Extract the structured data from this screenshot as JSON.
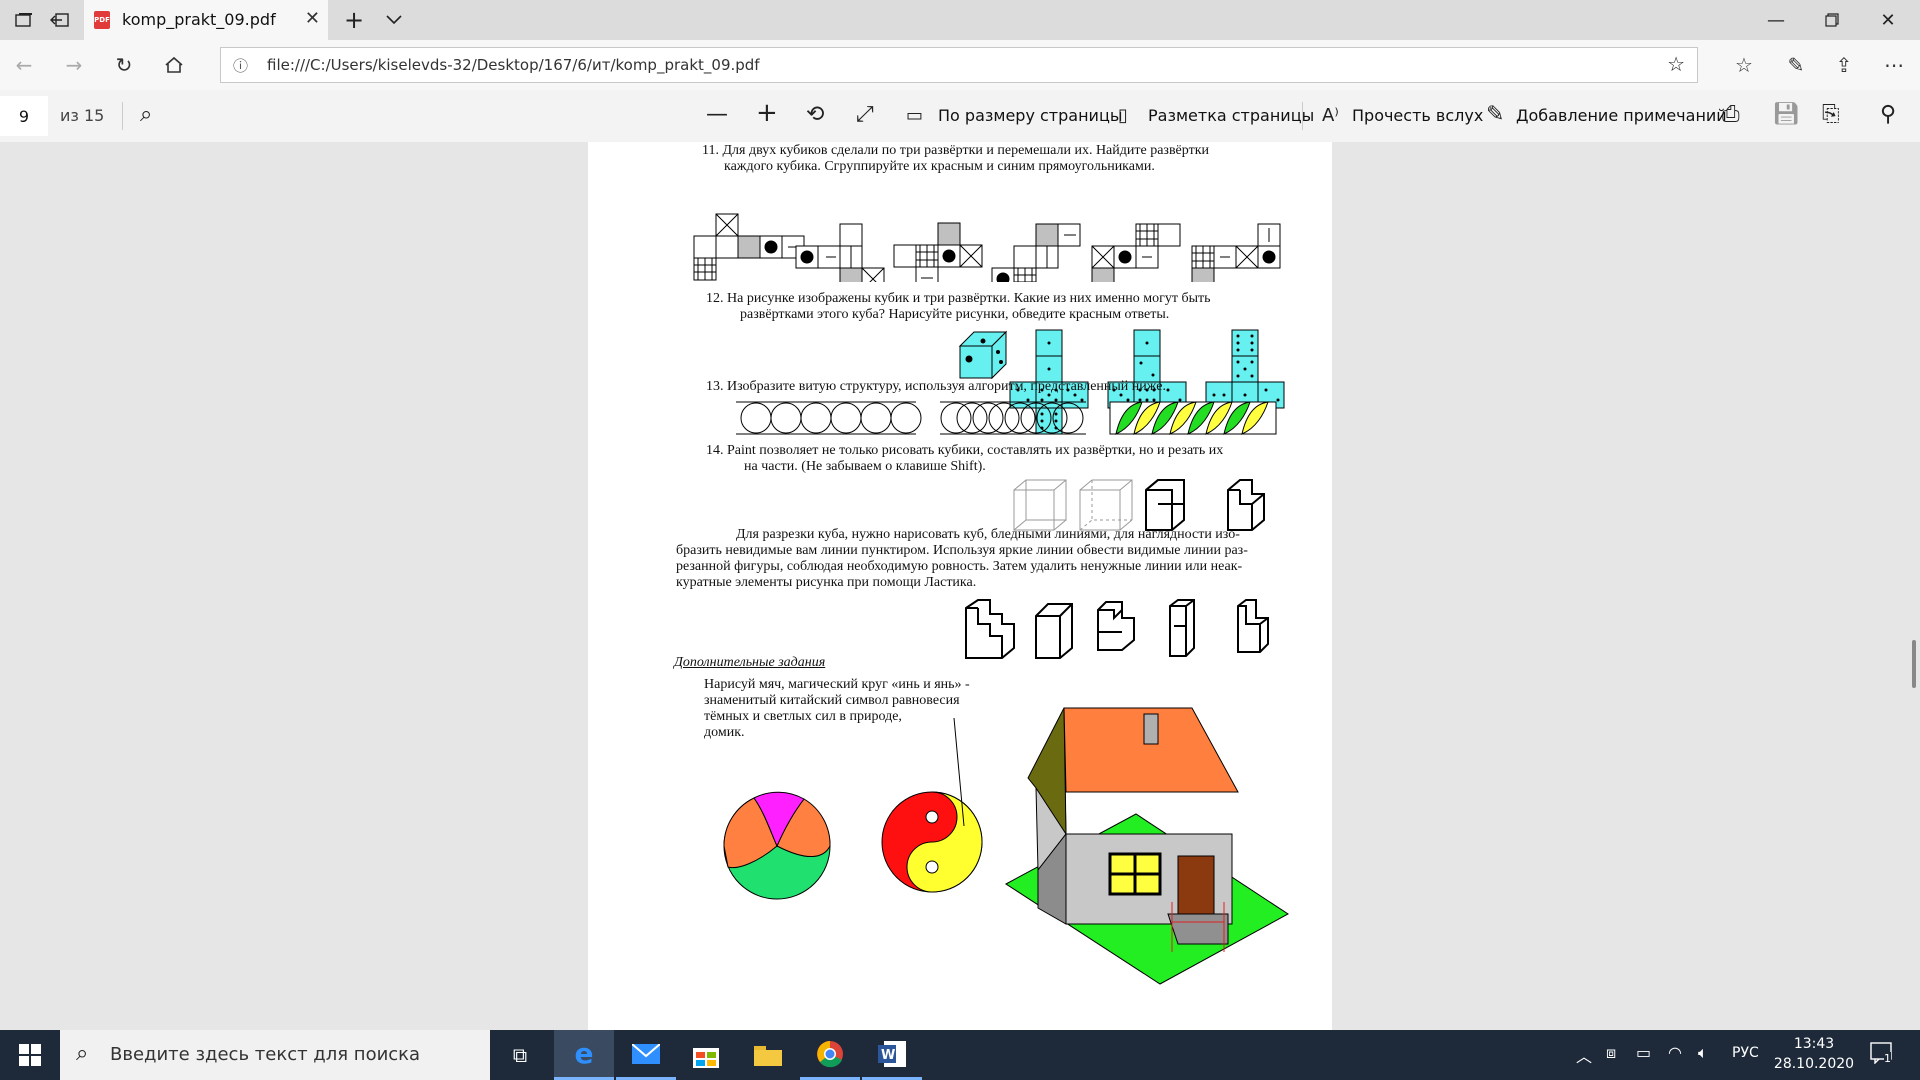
{
  "browser": {
    "tab_title": "komp_prakt_09.pdf",
    "url": "file:///C:/Users/kiselevds-32/Desktop/167/6/ит/komp_prakt_09.pdf"
  },
  "pdf_toolbar": {
    "page_number": "9",
    "page_total": "из 15",
    "fit_page": "По размеру страницы",
    "page_layout": "Разметка страницы",
    "read_aloud": "Прочесть вслух",
    "add_notes": "Добавление примечаний"
  },
  "document": {
    "task11_line1": "11. Для двух кубиков сделали по три развёртки и перемешали их.  Найдите развёртки",
    "task11_line2": "каждого кубика. Сгруппируйте их  красным и синим прямоугольниками.",
    "task12_line1": "12.  На рисунке изображены кубик и три развёртки. Какие из них именно могут быть",
    "task12_line2": "развёртками этого куба? Нарисуйте рисунки, обведите красным ответы.",
    "task13": "13. Изобразите витую структуру, используя алгоритм, представленный ниже.",
    "task14_line1": "14.   Paint позволяет не только рисовать кубики, составлять их развёртки, но и резать их",
    "task14_line2": "на части. (Не забываем о клавише Shift).",
    "cut_p1": "Для разрезки куба, нужно нарисовать куб, бледными линиями, для наглядности изо-",
    "cut_p2": "бразить невидимые вам линии пунктиром. Используя яркие линии обвести видимые линии раз-",
    "cut_p3": "резанной фигуры, соблюдая необходимую ровность. Затем удалить ненужные линии или неак-",
    "cut_p4": "куратные элементы рисунка при помощи Ластика.",
    "extra_heading": "Дополнительные  задания",
    "extra_l1": "Нарисуй мяч,  магический  круг «инь  и  янь» -",
    "extra_l2": "знаменитый китайский символ равновесия",
    "extra_l3": "тёмных и светлых сил в природе,",
    "extra_l4": "домик."
  },
  "taskbar": {
    "search_placeholder": "Введите здесь текст для поиска",
    "language": "РУС",
    "time": "13:43",
    "date": "28.10.2020",
    "notification_count": "1"
  },
  "colors": {
    "cube_fill": "#66f0f0",
    "net_gray": "#c0c0c0",
    "roof": "#ff7f3f",
    "lawn": "#22ee22",
    "ball_orange": "#ff8040",
    "ball_green": "#20e070",
    "ball_magenta": "#ff20ff",
    "yin_red": "#ff1010",
    "yin_yellow": "#ffff30",
    "taskbar": "#1e2a3a"
  }
}
